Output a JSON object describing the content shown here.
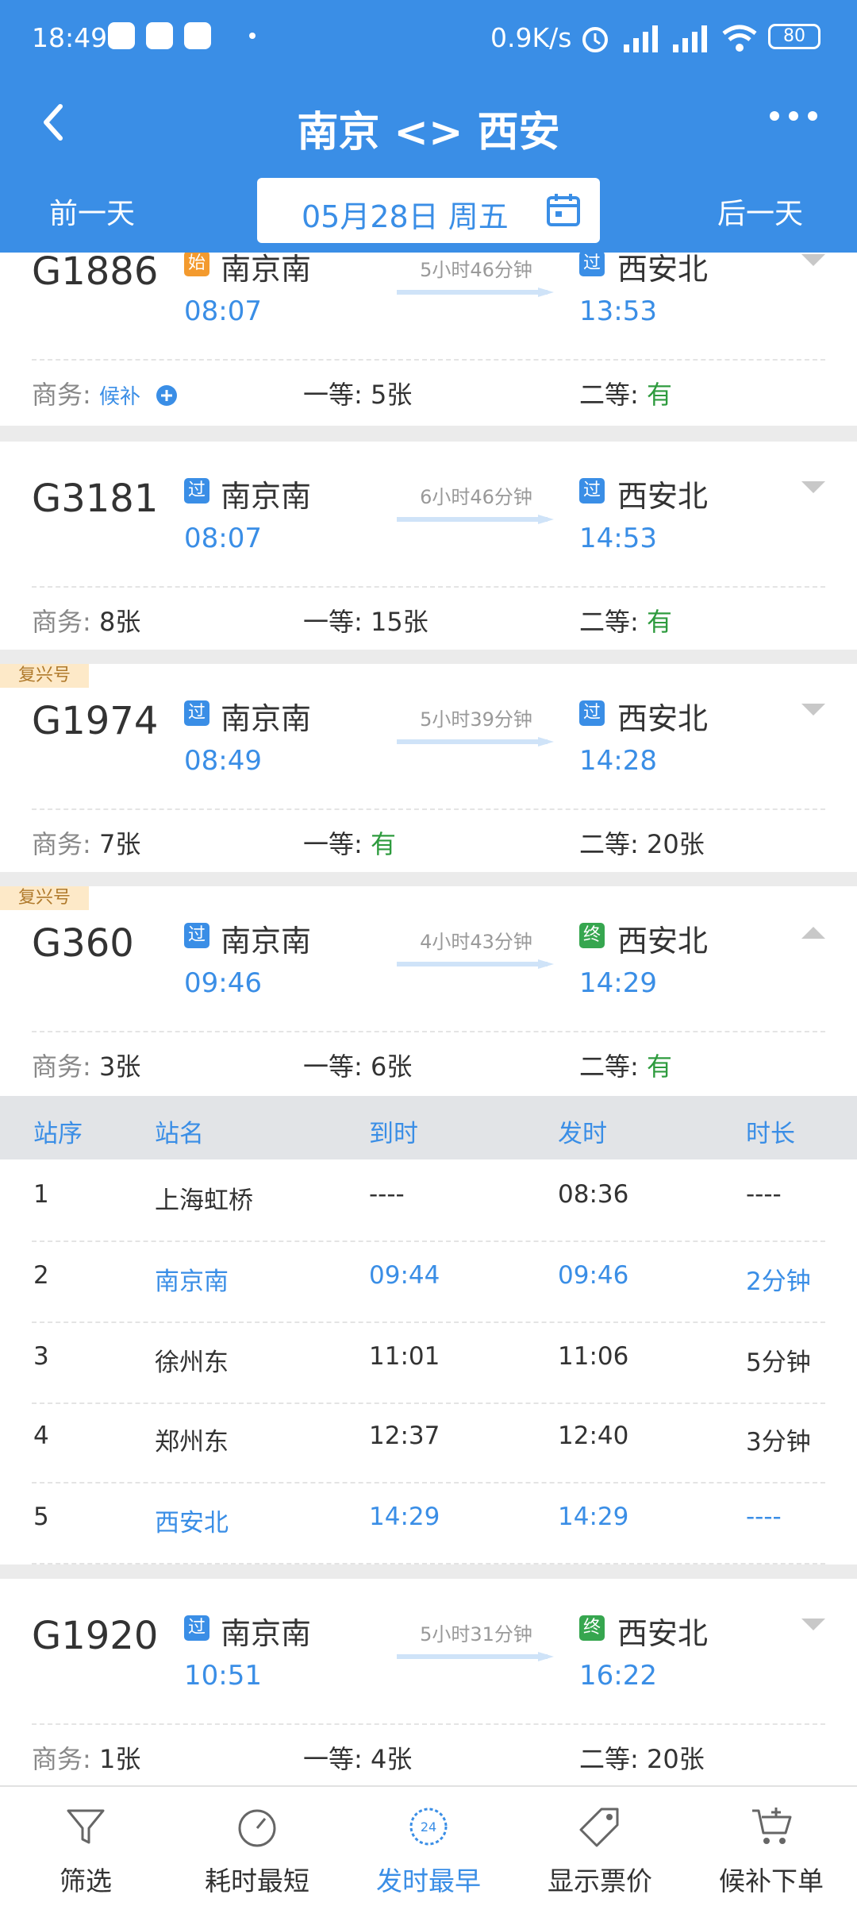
{
  "status_bar": {
    "time": "18:49",
    "speed": "0.9K/s",
    "battery": "80"
  },
  "header": {
    "title": "南京 <> 西安",
    "prev_day": "前一天",
    "next_day": "后一天",
    "date": "05月28日 周五"
  },
  "trains": [
    {
      "code": "G1886",
      "fuxing": "",
      "from_tag": "始",
      "from": "南京南",
      "dep": "08:07",
      "duration": "5小时46分钟",
      "to_tag": "过",
      "to": "西安北",
      "arr": "13:53",
      "seats": [
        {
          "label": "商务:",
          "value": "候补"
        },
        {
          "label": "一等:",
          "value": "5张"
        },
        {
          "label": "二等:",
          "value": "有"
        }
      ]
    },
    {
      "code": "G3181",
      "fuxing": "",
      "from_tag": "过",
      "from": "南京南",
      "dep": "08:07",
      "duration": "6小时46分钟",
      "to_tag": "过",
      "to": "西安北",
      "arr": "14:53",
      "seats": [
        {
          "label": "商务:",
          "value": "8张"
        },
        {
          "label": "一等:",
          "value": "15张"
        },
        {
          "label": "二等:",
          "value": "有"
        }
      ]
    },
    {
      "code": "G1974",
      "fuxing": "复兴号",
      "from_tag": "过",
      "from": "南京南",
      "dep": "08:49",
      "duration": "5小时39分钟",
      "to_tag": "过",
      "to": "西安北",
      "arr": "14:28",
      "seats": [
        {
          "label": "商务:",
          "value": "7张"
        },
        {
          "label": "一等:",
          "value": "有"
        },
        {
          "label": "二等:",
          "value": "20张"
        }
      ]
    },
    {
      "code": "G360",
      "fuxing": "复兴号",
      "from_tag": "过",
      "from": "南京南",
      "dep": "09:46",
      "duration": "4小时43分钟",
      "to_tag": "终",
      "to": "西安北",
      "arr": "14:29",
      "seats": [
        {
          "label": "商务:",
          "value": "3张"
        },
        {
          "label": "一等:",
          "value": "6张"
        },
        {
          "label": "二等:",
          "value": "有"
        }
      ]
    },
    {
      "code": "G1920",
      "fuxing": "",
      "from_tag": "过",
      "from": "南京南",
      "dep": "10:51",
      "duration": "5小时31分钟",
      "to_tag": "终",
      "to": "西安北",
      "arr": "16:22",
      "seats": [
        {
          "label": "商务:",
          "value": "1张"
        },
        {
          "label": "一等:",
          "value": "4张"
        },
        {
          "label": "二等:",
          "value": "20张"
        }
      ]
    }
  ],
  "stops": {
    "headers": [
      "站序",
      "站名",
      "到时",
      "发时",
      "时长"
    ],
    "rows": [
      [
        "1",
        "上海虹桥",
        "----",
        "08:36",
        "----"
      ],
      [
        "2",
        "南京南",
        "09:44",
        "09:46",
        "2分钟"
      ],
      [
        "3",
        "徐州东",
        "11:01",
        "11:06",
        "5分钟"
      ],
      [
        "4",
        "郑州东",
        "12:37",
        "12:40",
        "3分钟"
      ],
      [
        "5",
        "西安北",
        "14:29",
        "14:29",
        "----"
      ]
    ]
  },
  "bottom_tabs": [
    {
      "label": "筛选",
      "icon": "filter-icon"
    },
    {
      "label": "耗时最短",
      "icon": "timer-icon"
    },
    {
      "label": "发时最早",
      "icon": "clock-24-icon"
    },
    {
      "label": "显示票价",
      "icon": "price-tag-icon"
    },
    {
      "label": "候补下单",
      "icon": "cart-icon"
    }
  ],
  "colors": {
    "brand_blue": "#3a8ee6",
    "available_green": "#2e9b3e",
    "fuxing_badge": "#fde9c8"
  }
}
